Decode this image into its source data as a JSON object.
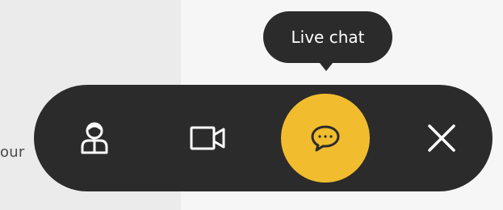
{
  "background": {
    "partial_text": "our"
  },
  "tooltip": {
    "text": "Live chat"
  },
  "toolbar": {
    "buttons": [
      {
        "name": "agent",
        "icon": "person-icon"
      },
      {
        "name": "video",
        "icon": "video-camera-icon"
      },
      {
        "name": "live-chat",
        "icon": "chat-bubble-icon",
        "active": true
      },
      {
        "name": "close",
        "icon": "close-icon"
      }
    ]
  },
  "colors": {
    "bar": "#2b2b2b",
    "accent": "#f1bd2e",
    "icon": "#ffffff"
  }
}
